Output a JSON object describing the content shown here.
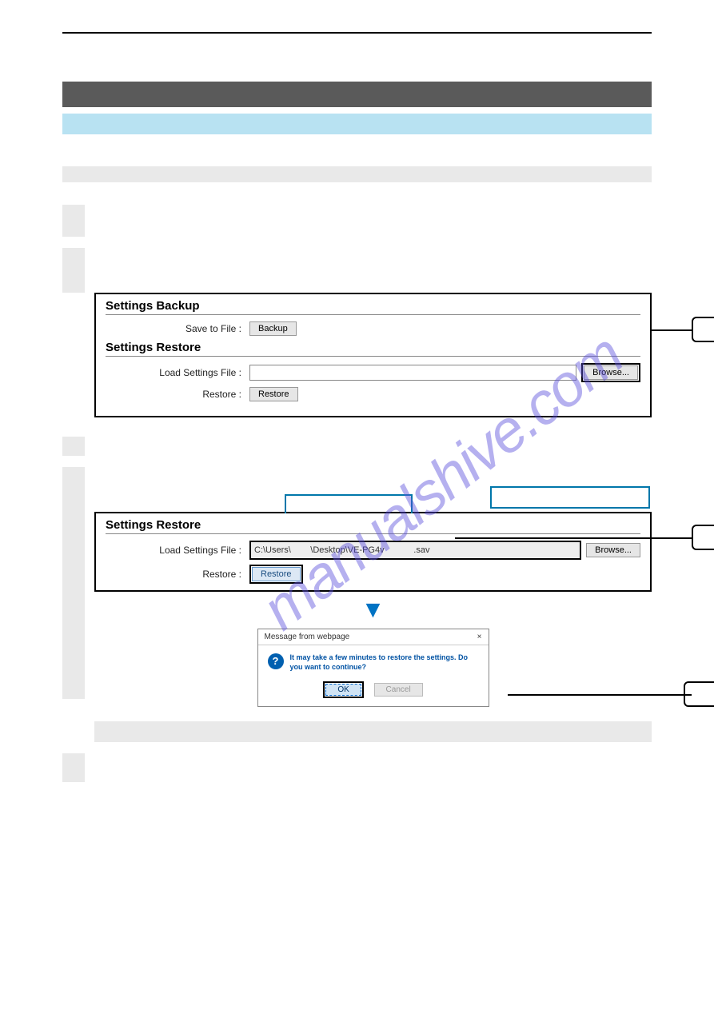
{
  "watermark": "manualshive.com",
  "panel1": {
    "backup_title": "Settings Backup",
    "save_to_file": "Save to File :",
    "backup_btn": "Backup",
    "restore_title": "Settings Restore",
    "load_label": "Load Settings File :",
    "browse_btn": "Browse...",
    "restore_label": "Restore :",
    "restore_btn": "Restore"
  },
  "panel2": {
    "restore_title": "Settings Restore",
    "load_label": "Load Settings File :",
    "file_value": "C:\\Users\\        \\Desktop\\VE-PG4v            .sav",
    "browse_btn": "Browse...",
    "restore_label": "Restore :",
    "restore_btn": "Restore"
  },
  "dialog": {
    "title": "Message from webpage",
    "close": "×",
    "body": "It may take a few minutes to restore the settings. Do you want to continue?",
    "ok": "OK",
    "cancel": "Cancel"
  }
}
